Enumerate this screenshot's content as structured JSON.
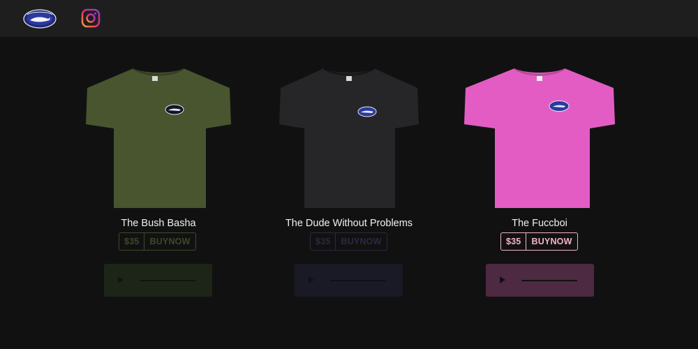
{
  "header": {
    "logo_icon": "brand-logo-oval",
    "instagram_icon": "instagram-icon"
  },
  "products": [
    {
      "name": "The Bush Basha",
      "price": "$35",
      "buy_label": "BUYNOW",
      "shirt_color": "#48552f",
      "accent_color": "#3b4a2a",
      "player_bg": "#1d2518",
      "player_fg": "#111510"
    },
    {
      "name": "The Dude Without Problems",
      "price": "$35",
      "buy_label": "BUYNOW",
      "shirt_color": "#262527",
      "accent_color": "#2a2a40",
      "player_bg": "#1a1a26",
      "player_fg": "#0f0f17"
    },
    {
      "name": "The Fuccboi",
      "price": "$35",
      "buy_label": "BUYNOW",
      "shirt_color": "#e35cc3",
      "accent_color": "#f3b3c9",
      "player_bg": "#4d2a42",
      "player_fg": "#111011"
    }
  ]
}
